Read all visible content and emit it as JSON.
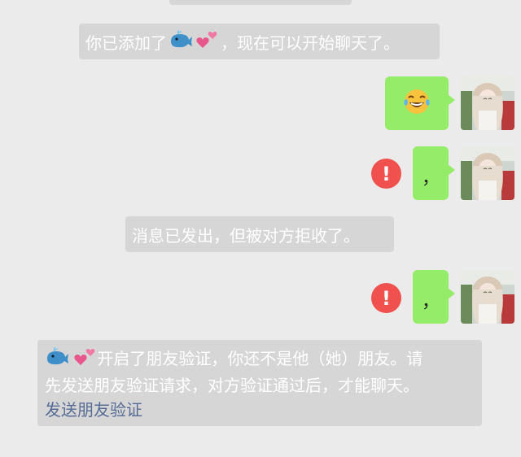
{
  "system_added": {
    "text_prefix": "你已添加了",
    "name_emoji": [
      "whale-emoji",
      "two-hearts-emoji"
    ],
    "text_suffix": "，现在可以开始聊天了。"
  },
  "messages": [
    {
      "type": "emoji",
      "emoji": "face-with-tears-of-joy",
      "failed": false
    },
    {
      "type": "text",
      "text": "，",
      "failed": true,
      "error_icon": "!"
    },
    {
      "type": "text",
      "text": "，",
      "failed": true,
      "error_icon": "!"
    }
  ],
  "system_rejected": {
    "text": "消息已发出，但被对方拒收了。"
  },
  "verification_notice": {
    "name_emoji": [
      "whale-emoji",
      "two-hearts-emoji"
    ],
    "line1": "开启了朋友验证，你还不是他（她）朋友。请",
    "line2": "先发送朋友验证请求，对方验证通过后，才能聊天。",
    "link": "发送朋友验证",
    "link_color": "#576b95"
  },
  "colors": {
    "bubble": "#95ec69",
    "error": "#f0504e",
    "system_bg": "#d6d6d6"
  }
}
